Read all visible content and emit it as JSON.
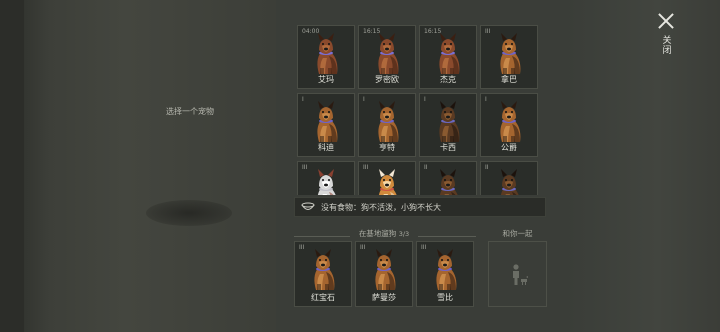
{
  "left_panel": {
    "hint": "选择一个宠物"
  },
  "close": {
    "label": "关闭"
  },
  "pets": [
    {
      "name": "艾玛",
      "tag": "04:00",
      "color": "brown"
    },
    {
      "name": "罗密欧",
      "tag": "16:15",
      "color": "brown"
    },
    {
      "name": "杰克",
      "tag": "16:15",
      "color": "brown"
    },
    {
      "name": "拿巴",
      "tag": "III",
      "color": "shepherd"
    },
    {
      "name": "科迪",
      "tag": "I",
      "color": "shepherd"
    },
    {
      "name": "亨特",
      "tag": "I",
      "color": "shepherd"
    },
    {
      "name": "卡西",
      "tag": "I",
      "color": "dark"
    },
    {
      "name": "公爵",
      "tag": "I",
      "color": "shepherd"
    },
    {
      "name": "",
      "tag": "III",
      "color": "husky"
    },
    {
      "name": "",
      "tag": "III",
      "color": "shiba"
    },
    {
      "name": "",
      "tag": "II",
      "color": "dark"
    },
    {
      "name": "",
      "tag": "II",
      "color": "dark"
    }
  ],
  "food_status": {
    "text": "没有食物：狗不活泼，小狗不长大"
  },
  "base": {
    "label": "在基地遛狗",
    "count": "3/3",
    "pets": [
      {
        "name": "红宝石",
        "tag": "III",
        "color": "shepherd"
      },
      {
        "name": "萨曼莎",
        "tag": "III",
        "color": "shepherd"
      },
      {
        "name": "雪比",
        "tag": "III",
        "color": "shepherd"
      }
    ]
  },
  "with_you": {
    "label": "和你一起"
  },
  "icons": {
    "close": "close-icon",
    "bowl": "food-bowl-icon",
    "person": "person-with-dog-icon"
  }
}
